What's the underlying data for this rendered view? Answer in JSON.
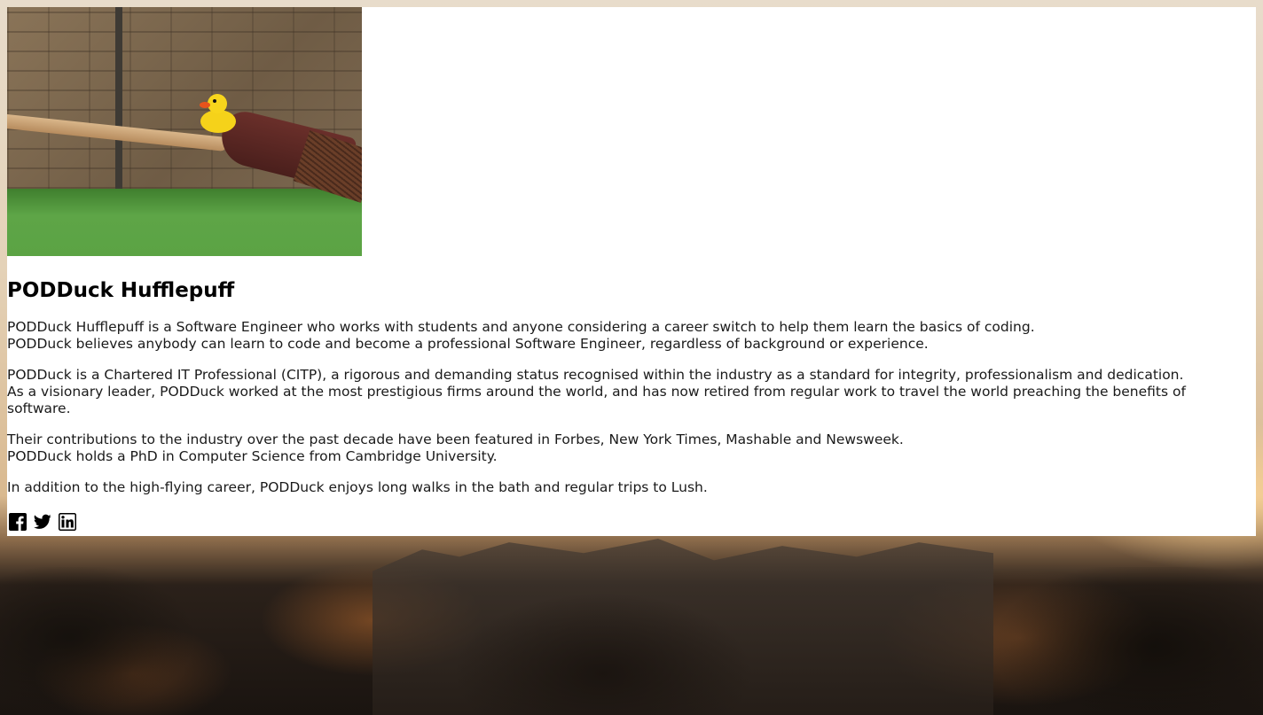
{
  "profile": {
    "name": "PODDuck Hufflepuff",
    "photo_alt": "PODDuck Hufflepuff photo",
    "bio": [
      {
        "lines": [
          "PODDuck Hufflepuff is a Software Engineer who works with students and anyone considering a career switch to help them learn the basics of coding.",
          "PODDuck believes anybody can learn to code and become a professional Software Engineer, regardless of background or experience."
        ]
      },
      {
        "lines": [
          "PODDuck is a Chartered IT Professional (CITP), a rigorous and demanding status recognised within the industry as a standard for integrity, professionalism and dedication.",
          "As a visionary leader, PODDuck worked at the most prestigious firms around the world, and has now retired from regular work to travel the world preaching the benefits of software."
        ]
      },
      {
        "lines": [
          "Their contributions to the industry over the past decade have been featured in Forbes, New York Times, Mashable and Newsweek.",
          "PODDuck holds a PhD in Computer Science from Cambridge University."
        ]
      },
      {
        "lines": [
          "In addition to the high-flying career, PODDuck enjoys long walks in the bath and regular trips to Lush."
        ]
      }
    ]
  },
  "social_links": [
    {
      "icon": "facebook-icon"
    },
    {
      "icon": "twitter-icon"
    },
    {
      "icon": "linkedin-icon"
    }
  ],
  "colors": {
    "card_background": "#ffffff",
    "text": "#1a1a1a",
    "heading": "#000000"
  }
}
